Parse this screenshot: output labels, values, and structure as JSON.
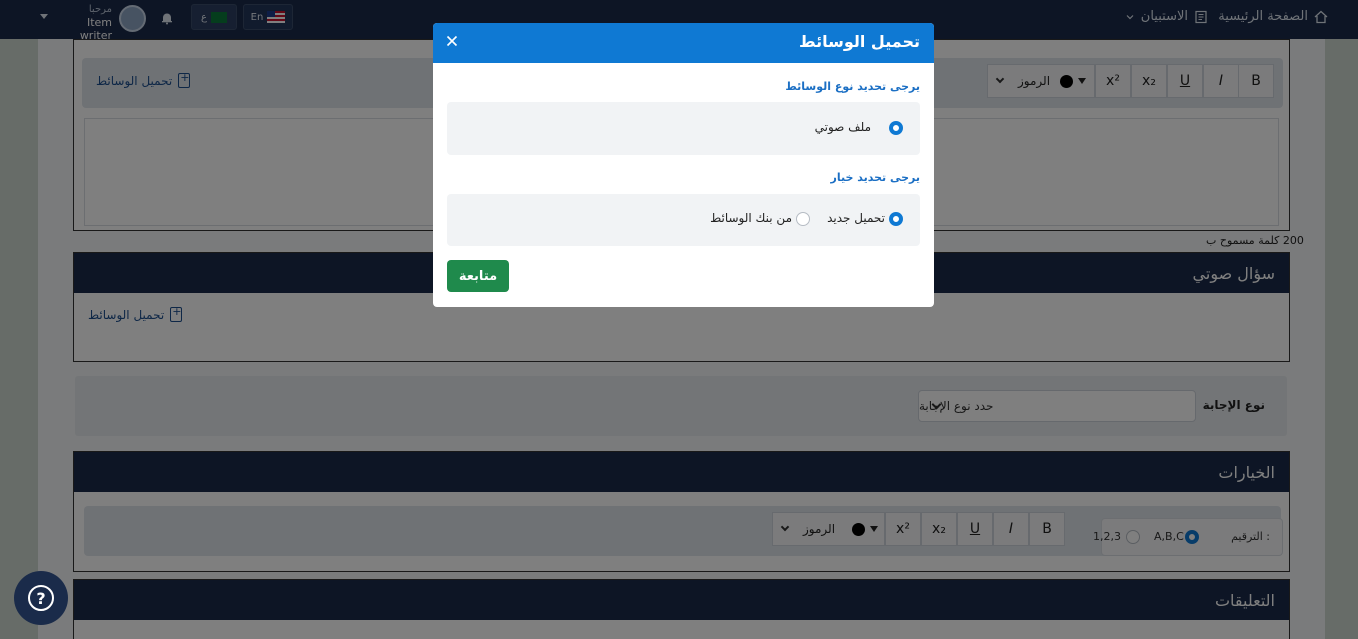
{
  "header": {
    "home_label": "الصفحة الرئيسية",
    "exams_label": "الاستبيان",
    "lang_en": "En",
    "lang_ar": "ع",
    "user_greeting": "مرحبا",
    "user_name": "Item writer"
  },
  "editor": {
    "upload_label": "تحميل الوسائط",
    "toolbar": {
      "bold": "B",
      "italic": "I",
      "underline": "U",
      "subscript": "x₂",
      "superscript": "x²",
      "symbols": "الرموز"
    },
    "word_limit": "200 كلمة مسموح ب"
  },
  "audio_question": {
    "title": "سؤال صوتي",
    "upload_label": "تحميل الوسائط"
  },
  "answer_type": {
    "label": "نوع الإجابة",
    "select_placeholder": "حدد نوع الإجابة"
  },
  "options": {
    "title": "الخيارات",
    "numbering_label": "الترقيم :",
    "numbering_abc": "A,B,C",
    "numbering_123": "1,2,3"
  },
  "comments": {
    "title": "التعليقات"
  },
  "modal": {
    "title": "تحميل الوسائط",
    "media_type_prompt": "يرجى تحديد نوع الوسائط",
    "media_type_option": "ملف صوتي",
    "choice_prompt": "يرجى تحديد خيار",
    "choice_new_upload": "تحميل جديد",
    "choice_media_bank": "من بنك الوسائط",
    "continue_label": "متابعة"
  },
  "icons": {
    "home": "home-icon",
    "survey": "survey-icon",
    "bell": "bell-icon",
    "help": "help-icon",
    "close": "close-icon",
    "upload": "file-upload-icon"
  },
  "colors": {
    "primary": "#0f79d3",
    "navy": "#1a2b4a",
    "success": "#1f8a4c"
  }
}
